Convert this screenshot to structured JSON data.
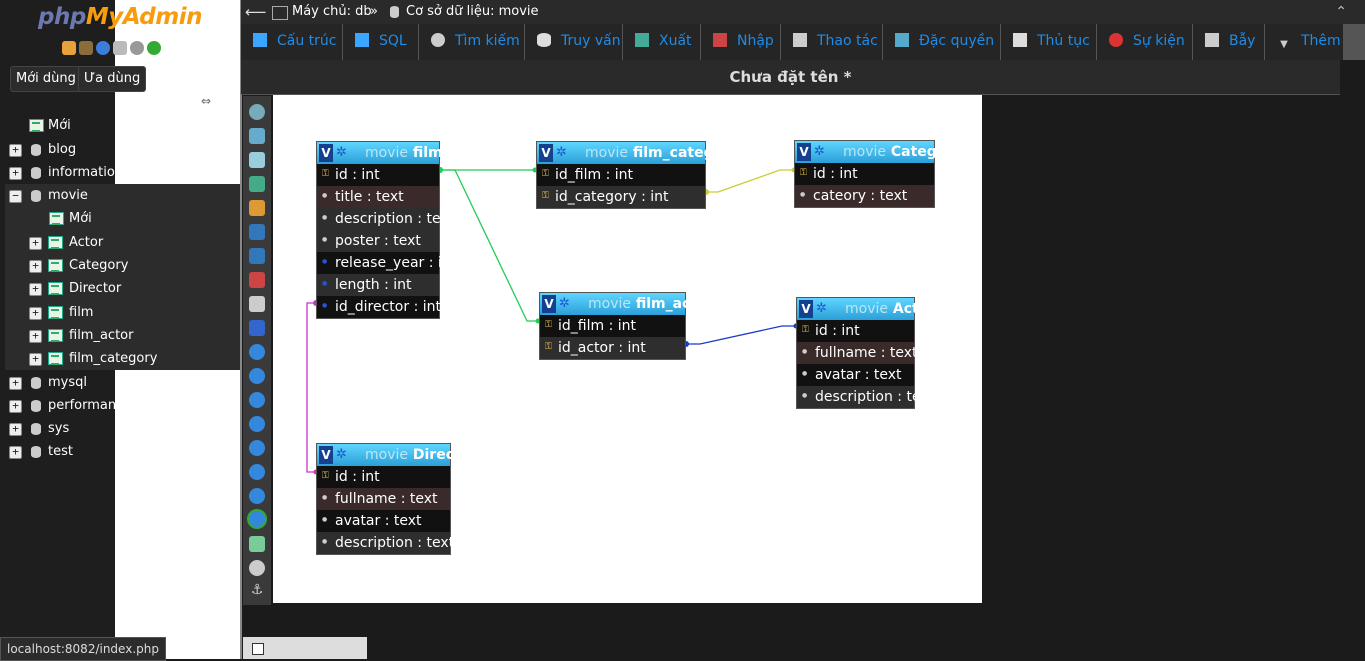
{
  "logo": {
    "php": "php",
    "myadmin": "MyAdmin"
  },
  "nav_buttons": {
    "recent": "Mới dùng",
    "favorites": "Ưa dùng"
  },
  "tree": {
    "new": "Mới",
    "databases": [
      "blog",
      "information_schema",
      "movie",
      "mysql",
      "performance_schema",
      "sys",
      "test"
    ],
    "movie_children": {
      "new": "Mới",
      "tables": [
        "Actor",
        "Category",
        "Director",
        "film",
        "film_actor",
        "film_category"
      ]
    }
  },
  "breadcrumb": {
    "server": "Máy chủ: db",
    "sep": "»",
    "database": "Cơ sở dữ liệu: movie"
  },
  "tabs": [
    "Cấu trúc",
    "SQL",
    "Tìm kiếm",
    "Truy vấn",
    "Xuất",
    "Nhập",
    "Thao tác",
    "Đặc quyền",
    "Thủ tục",
    "Sự kiện",
    "Bẫy",
    "Thêm"
  ],
  "designer_title": "Chưa đặt tên *",
  "designer_tables": {
    "film": {
      "schema": "movie",
      "name": "film",
      "columns": [
        "id : int",
        "title : text",
        "description : text",
        "poster : text",
        "release_year : int",
        "length : int",
        "id_director : int"
      ]
    },
    "film_category": {
      "schema": "movie",
      "name": "film_category",
      "columns": [
        "id_film : int",
        "id_category : int"
      ]
    },
    "category": {
      "schema": "movie",
      "name": "Category",
      "columns": [
        "id : int",
        "cateory : text"
      ]
    },
    "film_actor": {
      "schema": "movie",
      "name": "film_actor",
      "columns": [
        "id_film : int",
        "id_actor : int"
      ]
    },
    "actor": {
      "schema": "movie",
      "name": "Actor",
      "columns": [
        "id : int",
        "fullname : text",
        "avatar : text",
        "description : text"
      ]
    },
    "director": {
      "schema": "movie",
      "name": "Director",
      "columns": [
        "id : int",
        "fullname : text",
        "avatar : text",
        "description : text"
      ]
    }
  },
  "table_toggle_label": "V",
  "status_url": "localhost:8082/index.php",
  "colors": {
    "accent": "#1e8ce8",
    "header_top": "#5ed6ff",
    "header_bottom": "#2b9fd8",
    "rel_green": "#22cc55",
    "rel_yellow": "#cccc33",
    "rel_blue": "#1a3acc",
    "rel_magenta": "#cc33cc"
  },
  "icons": [
    "home-icon",
    "exit-icon",
    "help-icon",
    "docs-icon",
    "settings-icon",
    "reload-icon",
    "link-icon",
    "key-icon",
    "column-icon"
  ]
}
